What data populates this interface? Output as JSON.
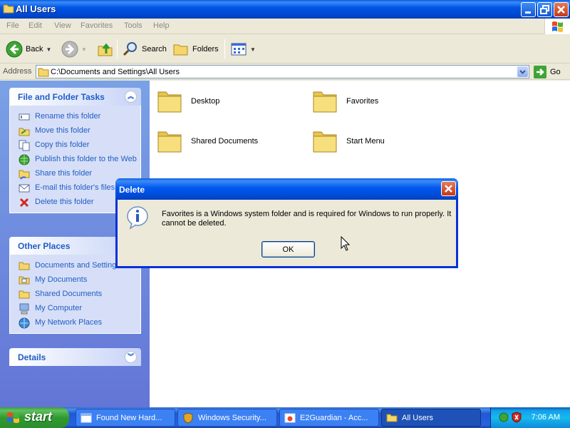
{
  "window": {
    "title": "All Users",
    "menu": [
      "File",
      "Edit",
      "View",
      "Favorites",
      "Tools",
      "Help"
    ],
    "toolbar": {
      "back_label": "Back",
      "search_label": "Search",
      "folders_label": "Folders"
    },
    "address": {
      "label": "Address",
      "value": "C:\\Documents and Settings\\All Users",
      "go_label": "Go"
    }
  },
  "tasks_pane": {
    "file_folder_tasks": {
      "title": "File and Folder Tasks",
      "items": [
        {
          "label": "Rename this folder",
          "icon": "rename-icon"
        },
        {
          "label": "Move this folder",
          "icon": "move-icon"
        },
        {
          "label": "Copy this folder",
          "icon": "copy-icon"
        },
        {
          "label": "Publish this folder to the Web",
          "icon": "publish-web-icon"
        },
        {
          "label": "Share this folder",
          "icon": "share-icon"
        },
        {
          "label": "E-mail this folder's files",
          "icon": "email-icon"
        },
        {
          "label": "Delete this folder",
          "icon": "delete-icon"
        }
      ]
    },
    "other_places": {
      "title": "Other Places",
      "items": [
        {
          "label": "Documents and Settings",
          "icon": "folder-icon"
        },
        {
          "label": "My Documents",
          "icon": "my-documents-icon"
        },
        {
          "label": "Shared Documents",
          "icon": "folder-icon"
        },
        {
          "label": "My Computer",
          "icon": "my-computer-icon"
        },
        {
          "label": "My Network Places",
          "icon": "network-places-icon"
        }
      ]
    },
    "details": {
      "title": "Details"
    }
  },
  "folders": [
    {
      "label": "Desktop"
    },
    {
      "label": "Favorites"
    },
    {
      "label": "Shared Documents"
    },
    {
      "label": "Start Menu"
    }
  ],
  "dialog": {
    "title": "Delete",
    "message": "Favorites is a Windows system folder and is required for Windows to run properly. It cannot be deleted.",
    "ok_label": "OK"
  },
  "taskbar": {
    "start_label": "start",
    "tasks": [
      {
        "label": "Found New Hard...",
        "icon": "window-icon"
      },
      {
        "label": "Windows Security...",
        "icon": "security-shield-icon"
      },
      {
        "label": "E2Guardian - Acc...",
        "icon": "browser-icon"
      },
      {
        "label": "All Users",
        "icon": "folder-icon"
      }
    ],
    "clock": "7:06 AM"
  },
  "colors": {
    "title_blue": "#0055e5",
    "task_link": "#215dc6",
    "pane_blue": "#6375d6"
  }
}
